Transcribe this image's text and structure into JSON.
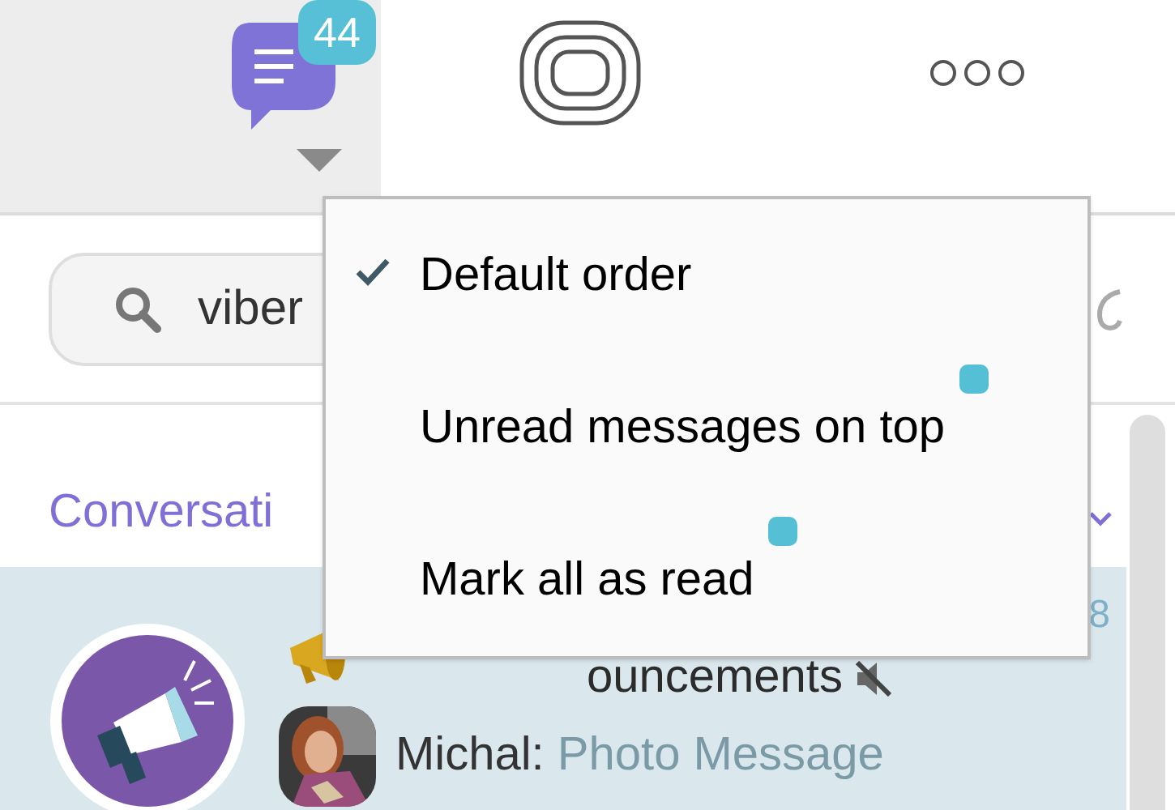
{
  "tabs": [
    {
      "kind": "chats",
      "badge": "44",
      "selected": true
    },
    {
      "kind": "stories",
      "selected": false
    },
    {
      "kind": "more",
      "selected": false
    }
  ],
  "search": {
    "value": "viber"
  },
  "section": {
    "title": "Conversati"
  },
  "conversations": [
    {
      "name": "ouncements",
      "time": "8",
      "muted": true,
      "sender": "Michal:",
      "preview": "Photo Message",
      "selected": true
    }
  ],
  "menu": {
    "items": [
      {
        "label": "Default order",
        "checked": true,
        "dot": false
      },
      {
        "label": "Unread messages on top",
        "checked": false,
        "dot": true
      },
      {
        "label": "Mark all as read",
        "checked": false,
        "dot": true
      }
    ]
  }
}
